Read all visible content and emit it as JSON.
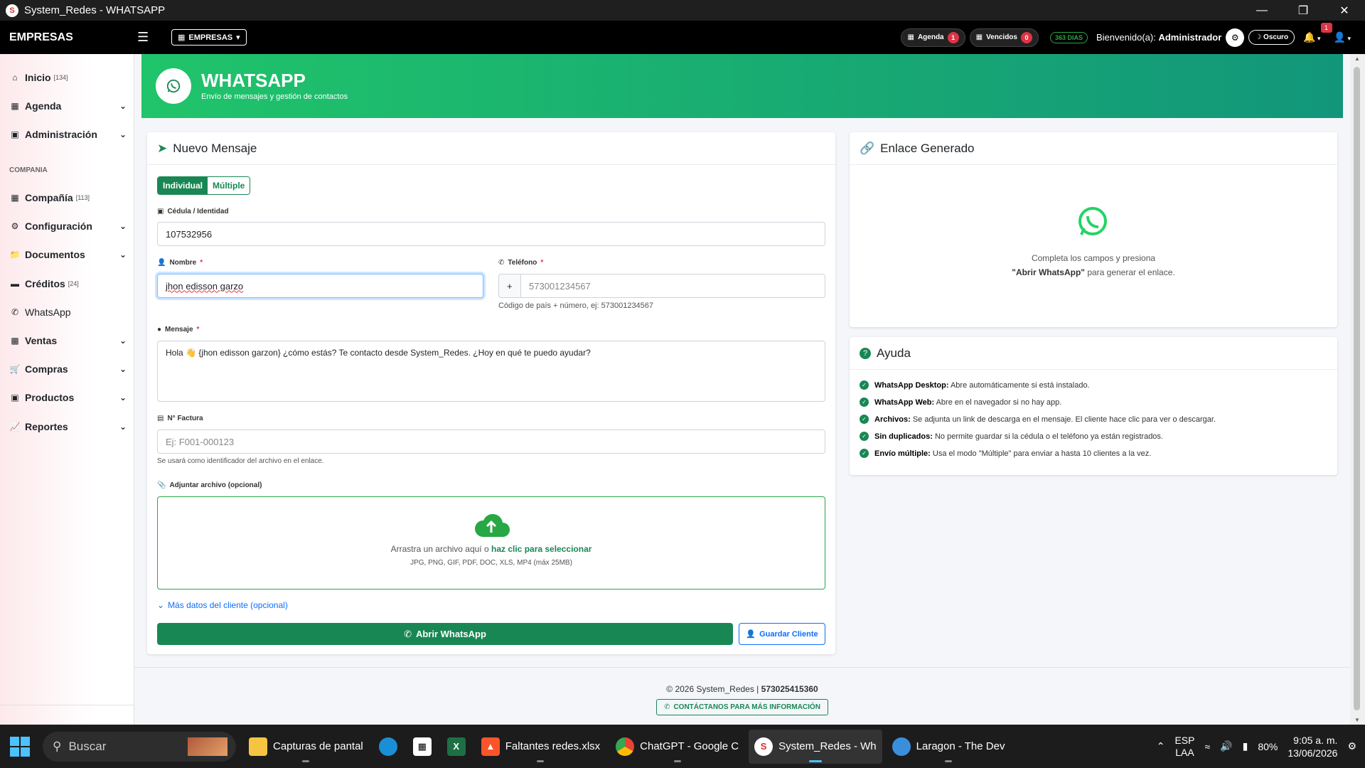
{
  "window": {
    "title": "System_Redes - WHATSAPP",
    "app_icon_letter": "S"
  },
  "navbar": {
    "brand": "EMPRESAS",
    "empresas_button": "EMPRESAS",
    "agenda_label": "Agenda",
    "agenda_count": "1",
    "vencidos_label": "Vencidos",
    "vencidos_count": "0",
    "days_badge": "363 DIAS",
    "welcome_prefix": "Bienvenido(a):",
    "welcome_user": "Administrador",
    "theme_label": "Oscuro",
    "notifications_count": "1"
  },
  "sidebar": {
    "items": [
      {
        "label": "Inicio",
        "count": "[134]"
      },
      {
        "label": "Agenda"
      },
      {
        "label": "Administración"
      },
      {
        "label": "Compañía",
        "count": "[113]"
      },
      {
        "label": "Configuración"
      },
      {
        "label": "Documentos"
      },
      {
        "label": "Créditos",
        "count": "[24]"
      },
      {
        "label": "WhatsApp"
      },
      {
        "label": "Ventas"
      },
      {
        "label": "Compras"
      },
      {
        "label": "Productos"
      },
      {
        "label": "Reportes"
      }
    ],
    "section_label": "COMPANIA"
  },
  "banner": {
    "title": "WHATSAPP",
    "subtitle": "Envío de mensajes y gestión de contactos"
  },
  "form": {
    "title": "Nuevo Mensaje",
    "mode_individual": "Individual",
    "mode_multiple": "Múltiple",
    "cedula_label": "Cédula / Identidad",
    "cedula_value": "107532956",
    "nombre_label": "Nombre",
    "nombre_value": "jhon edisson garzo",
    "telefono_label": "Teléfono",
    "telefono_prefix": "+",
    "telefono_placeholder": "573001234567",
    "telefono_help": "Código de país + número, ej: 573001234567",
    "mensaje_label": "Mensaje",
    "mensaje_value": "Hola 👋 {jhon edisson garzon} ¿cómo estás? Te contacto desde System_Redes. ¿Hoy en qué te puedo ayudar?",
    "factura_label": "N° Factura",
    "factura_placeholder": "Ej: F001-000123",
    "factura_help": "Se usará como identificador del archivo en el enlace.",
    "adjuntar_label": "Adjuntar archivo (opcional)",
    "drop_text": "Arrastra un archivo aquí o",
    "drop_link": "haz clic para seleccionar",
    "drop_formats": "JPG, PNG, GIF, PDF, DOC, XLS, MP4 (máx 25MB)",
    "more_data": "Más datos del cliente (opcional)",
    "open_whatsapp": "Abrir WhatsApp",
    "save_client": "Guardar Cliente",
    "required_mark": "*"
  },
  "link_card": {
    "title": "Enlace Generado",
    "line1": "Completa los campos y presiona",
    "line2_bold": "\"Abrir WhatsApp\"",
    "line2_rest": "para generar el enlace."
  },
  "help_card": {
    "title": "Ayuda",
    "items": [
      {
        "bold": "WhatsApp Desktop:",
        "text": "Abre automáticamente si está instalado."
      },
      {
        "bold": "WhatsApp Web:",
        "text": "Abre en el navegador si no hay app."
      },
      {
        "bold": "Archivos:",
        "text": "Se adjunta un link de descarga en el mensaje. El cliente hace clic para ver o descargar."
      },
      {
        "bold": "Sin duplicados:",
        "text": "No permite guardar si la cédula o el teléfono ya están registrados."
      },
      {
        "bold": "Envío múltiple:",
        "text": "Usa el modo \"Múltiple\" para enviar a hasta 10 clientes a la vez."
      }
    ]
  },
  "footer": {
    "copyright": "© 2026 System_Redes |",
    "phone": "573025415360",
    "contact_button": "CONTÁCTANOS PARA MÁS INFORMACIÓN"
  },
  "taskbar": {
    "search_placeholder": "Buscar",
    "apps": [
      {
        "label": "Capturas de pantal"
      },
      {
        "label": "Faltantes redes.xlsx"
      },
      {
        "label": "ChatGPT - Google C"
      },
      {
        "label": "System_Redes - Wh"
      },
      {
        "label": "Laragon - The Dev"
      }
    ],
    "lang1": "ESP",
    "lang2": "LAA",
    "battery": "80%",
    "time": "9:05 a. m.",
    "date": "13/06/2026"
  },
  "colors": {
    "brand_green": "#198754",
    "banner_start": "#20c46a",
    "banner_end": "#12967a",
    "whatsapp": "#25d366"
  }
}
